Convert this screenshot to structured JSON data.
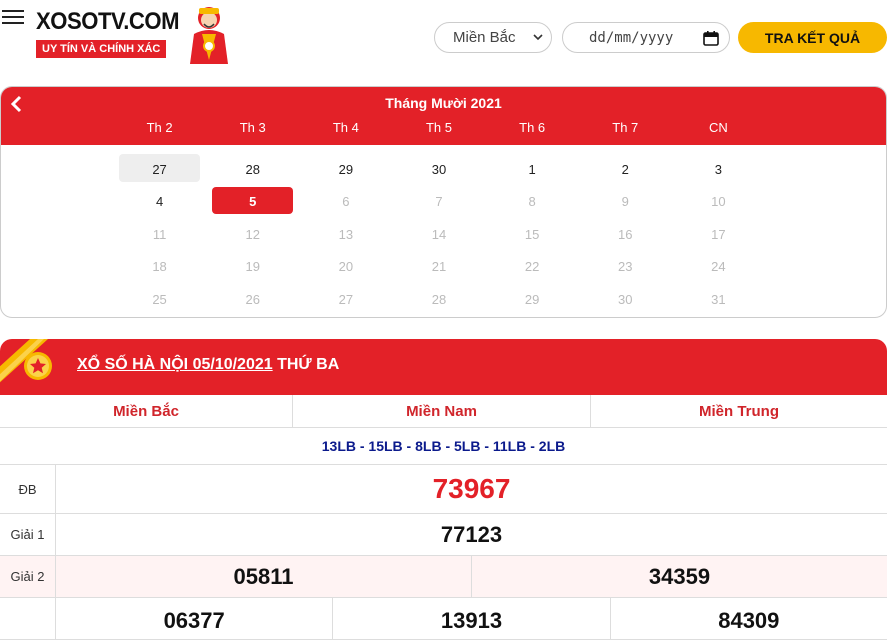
{
  "header": {
    "logo_title": "XOSOTV.COM",
    "logo_slogan": "UY TÍN VÀ CHÍNH XÁC",
    "region_selected": "Miền Bắc",
    "date_placeholder": "dd/mm/yyyy",
    "search_button": "TRA KẾT QUẢ"
  },
  "calendar": {
    "month_title": "Tháng Mười 2021",
    "weekdays": [
      "Th 2",
      "Th 3",
      "Th 4",
      "Th 5",
      "Th 6",
      "Th 7",
      "CN"
    ],
    "weeks": [
      [
        "27",
        "28",
        "29",
        "30",
        "1",
        "2",
        "3"
      ],
      [
        "4",
        "5",
        "6",
        "7",
        "8",
        "9",
        "10"
      ],
      [
        "11",
        "12",
        "13",
        "14",
        "15",
        "16",
        "17"
      ],
      [
        "18",
        "19",
        "20",
        "21",
        "22",
        "23",
        "24"
      ],
      [
        "25",
        "26",
        "27",
        "28",
        "29",
        "30",
        "31"
      ]
    ],
    "selected_day": "5"
  },
  "results": {
    "title_link": "XỔ SỐ HÀ NỘI 05/10/2021",
    "title_suffix": " THỨ BA",
    "region_tabs": [
      "Miền Bắc",
      "Miền Nam",
      "Miền Trung"
    ],
    "codes": "13LB - 15LB - 8LB - 5LB - 11LB - 2LB",
    "prizes": [
      {
        "label": "ĐB",
        "values": [
          "73967"
        ]
      },
      {
        "label": "Giải 1",
        "values": [
          "77123"
        ]
      },
      {
        "label": "Giải 2",
        "values": [
          "05811",
          "34359"
        ]
      },
      {
        "label": "",
        "values": [
          "06377",
          "13913",
          "84309"
        ]
      }
    ]
  },
  "colors": {
    "brand_red": "#e32128",
    "button_yellow": "#f7b800",
    "code_blue": "#0b1a8c"
  }
}
